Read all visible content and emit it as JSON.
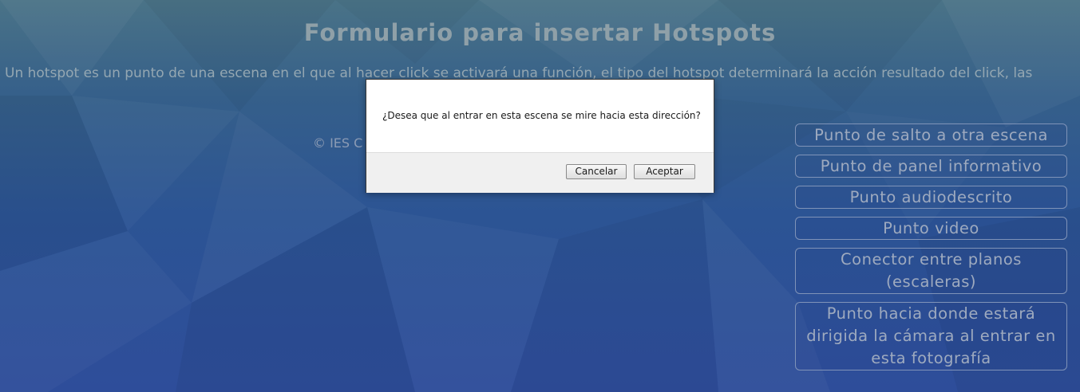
{
  "page": {
    "title": "Formulario para insertar Hotspots",
    "intro": "Un hotspot es un punto de una escena en el que al hacer click se activará una función, el tipo del hotspot determinará la acción resultado del click, las",
    "footer": "© IES C"
  },
  "menu": {
    "items": [
      {
        "label": "Punto de salto a otra escena"
      },
      {
        "label": "Punto de panel informativo"
      },
      {
        "label": "Punto audiodescrito"
      },
      {
        "label": "Punto video"
      },
      {
        "label": "Conector entre planos (escaleras)"
      },
      {
        "label": "Punto hacia donde estará dirigida la cámara al entrar en esta fotografía"
      }
    ]
  },
  "dialog": {
    "message": "¿Desea que al entrar en esta escena se mire hacia esta dirección?",
    "cancel_label": "Cancelar",
    "accept_label": "Aceptar"
  },
  "colors": {
    "background_top": "#4a7387",
    "background_bottom": "#2e4d9a",
    "text_muted": "#8fa0a8",
    "button_border": "#7f93b8"
  }
}
